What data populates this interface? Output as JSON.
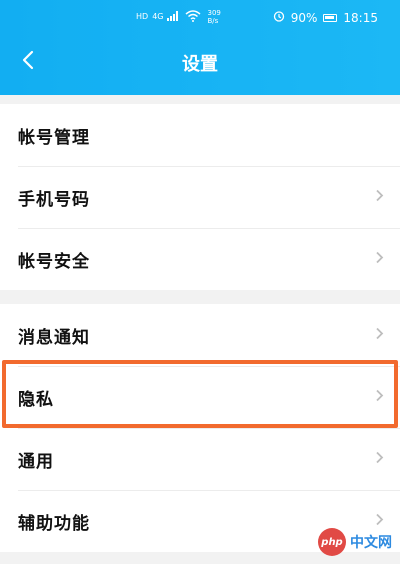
{
  "status_bar": {
    "net_type": "HD",
    "net_gen": "4G",
    "speed_value": "309",
    "speed_unit": "B/s",
    "battery_percent": "90%",
    "time": "18:15"
  },
  "header": {
    "title": "设置",
    "back_icon": "chevron-left-icon"
  },
  "sections": [
    {
      "items": [
        {
          "label": "帐号管理",
          "has_chevron": false
        },
        {
          "label": "手机号码",
          "has_chevron": true
        },
        {
          "label": "帐号安全",
          "has_chevron": true
        }
      ]
    },
    {
      "items": [
        {
          "label": "消息通知",
          "has_chevron": true
        },
        {
          "label": "隐私",
          "has_chevron": true
        },
        {
          "label": "通用",
          "has_chevron": true
        },
        {
          "label": "辅助功能",
          "has_chevron": true
        }
      ]
    }
  ],
  "watermark": {
    "badge": "php",
    "text": "中文网"
  },
  "colors": {
    "header_bg": "#12aef2",
    "highlight": "#f26a2e",
    "page_bg": "#f2f2f2"
  }
}
